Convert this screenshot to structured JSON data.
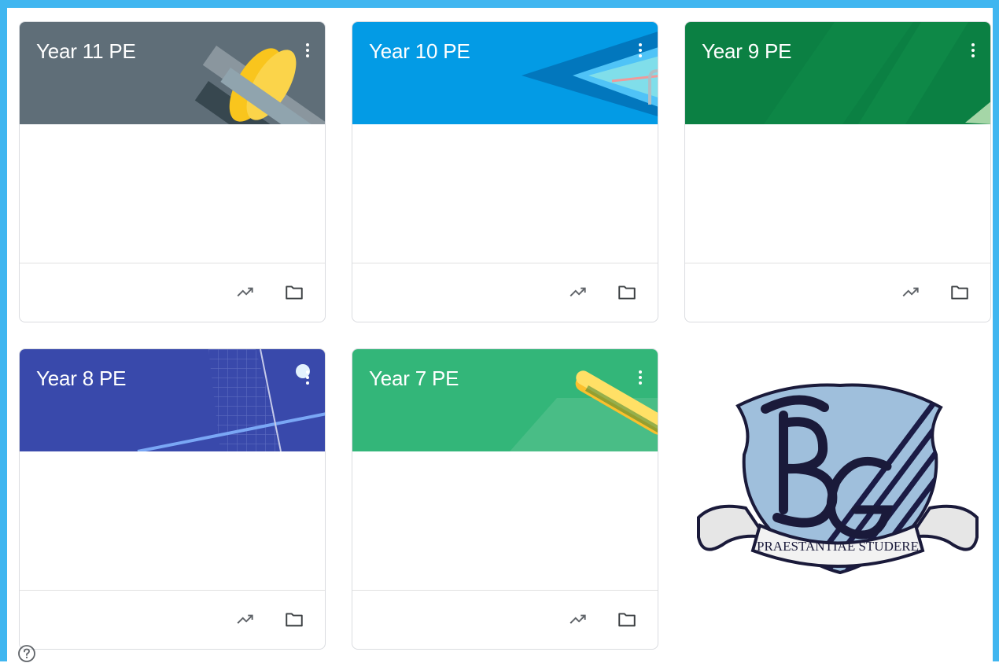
{
  "classes": [
    {
      "title": "Year 11 PE",
      "header_color": "#5f6e78",
      "theme": "weights"
    },
    {
      "title": "Year 10 PE",
      "header_color": "#039be5",
      "theme": "swimming-pool"
    },
    {
      "title": "Year 9 PE",
      "header_color": "#0b8043",
      "theme": "field"
    },
    {
      "title": "Year 8 PE",
      "header_color": "#3949ab",
      "theme": "tennis-net"
    },
    {
      "title": "Year 7 PE",
      "header_color": "#33b679",
      "theme": "hurdle"
    }
  ],
  "card_icons": {
    "gradebook": "trending-up-icon",
    "folder": "folder-icon",
    "menu": "more-vert-icon"
  },
  "crest": {
    "motto": "PRAESTANTIAE STUDERE",
    "monogram": "BG"
  },
  "help_icon": "help-circle-icon"
}
